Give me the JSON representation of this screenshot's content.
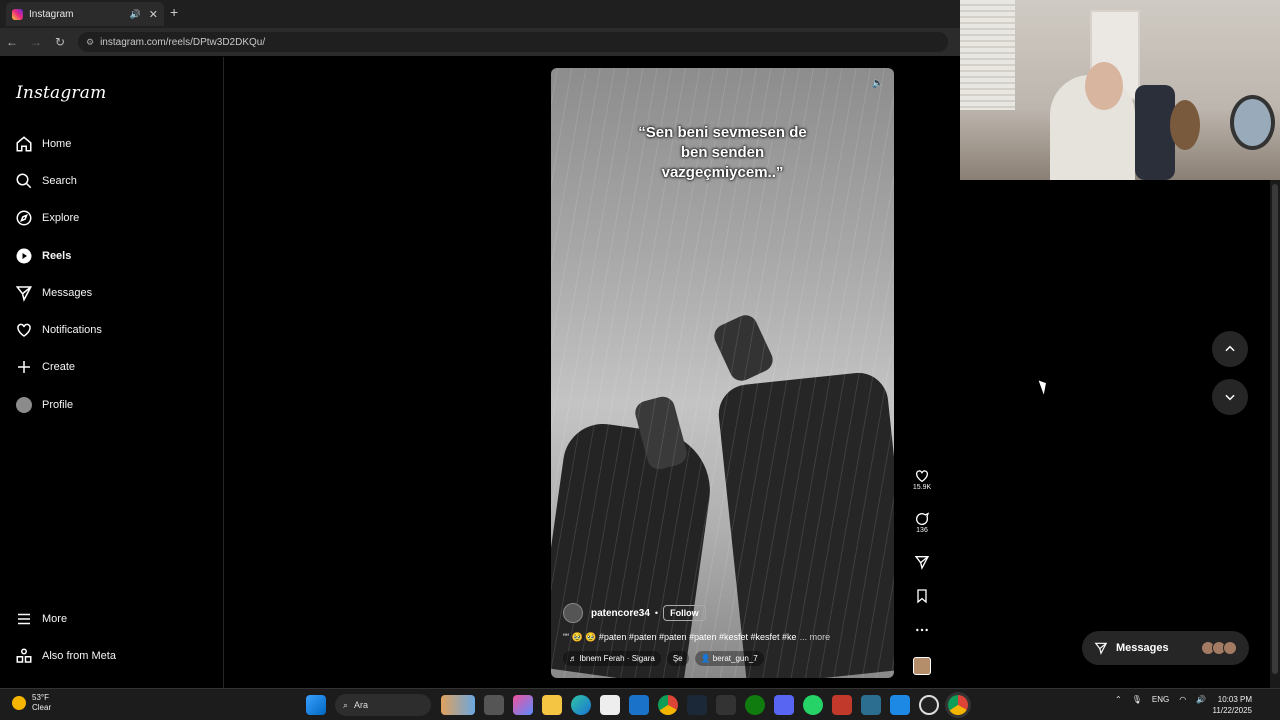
{
  "browser": {
    "tab_title": "Instagram",
    "url": "instagram.com/reels/DPtw3D2DKQu/",
    "new_tab_symbol": "+",
    "close_symbol": "✕"
  },
  "sidebar": {
    "logo": "Instagram",
    "items": [
      {
        "label": "Home",
        "icon": "home-icon"
      },
      {
        "label": "Search",
        "icon": "search-icon"
      },
      {
        "label": "Explore",
        "icon": "compass-icon"
      },
      {
        "label": "Reels",
        "icon": "reels-icon",
        "active": true
      },
      {
        "label": "Messages",
        "icon": "send-icon"
      },
      {
        "label": "Notifications",
        "icon": "heart-icon"
      },
      {
        "label": "Create",
        "icon": "plus-icon"
      },
      {
        "label": "Profile",
        "icon": "avatar-icon"
      }
    ],
    "bottom_items": [
      {
        "label": "More",
        "icon": "menu-icon"
      },
      {
        "label": "Also from Meta",
        "icon": "meta-icon"
      }
    ]
  },
  "reel": {
    "overlay_text": "“Sen beni sevmesen de\nben senden\nvazgeçmiycem..”",
    "author": "patencore34",
    "separator": "•",
    "follow_label": "Follow",
    "description": "““ 🥹 🥹 #paten #paten #paten #paten #kesfet #kesfet #ke",
    "more_label": "... more",
    "audio": "♬ Ibnem Ferah · Sigara",
    "audio_extra": "Şe",
    "tagged_user": "berat_gun_7"
  },
  "actions": {
    "likes": "15.9K",
    "comments": "136"
  },
  "messages_pill": {
    "label": "Messages"
  },
  "taskbar": {
    "temperature": "53°F",
    "condition": "Clear",
    "search_placeholder": "Ara",
    "language": "ENG",
    "time": "10:03 PM",
    "date": "11/22/2025"
  },
  "colors": {
    "background": "#000000",
    "surface": "#262626",
    "text": "#f5f5f5"
  }
}
